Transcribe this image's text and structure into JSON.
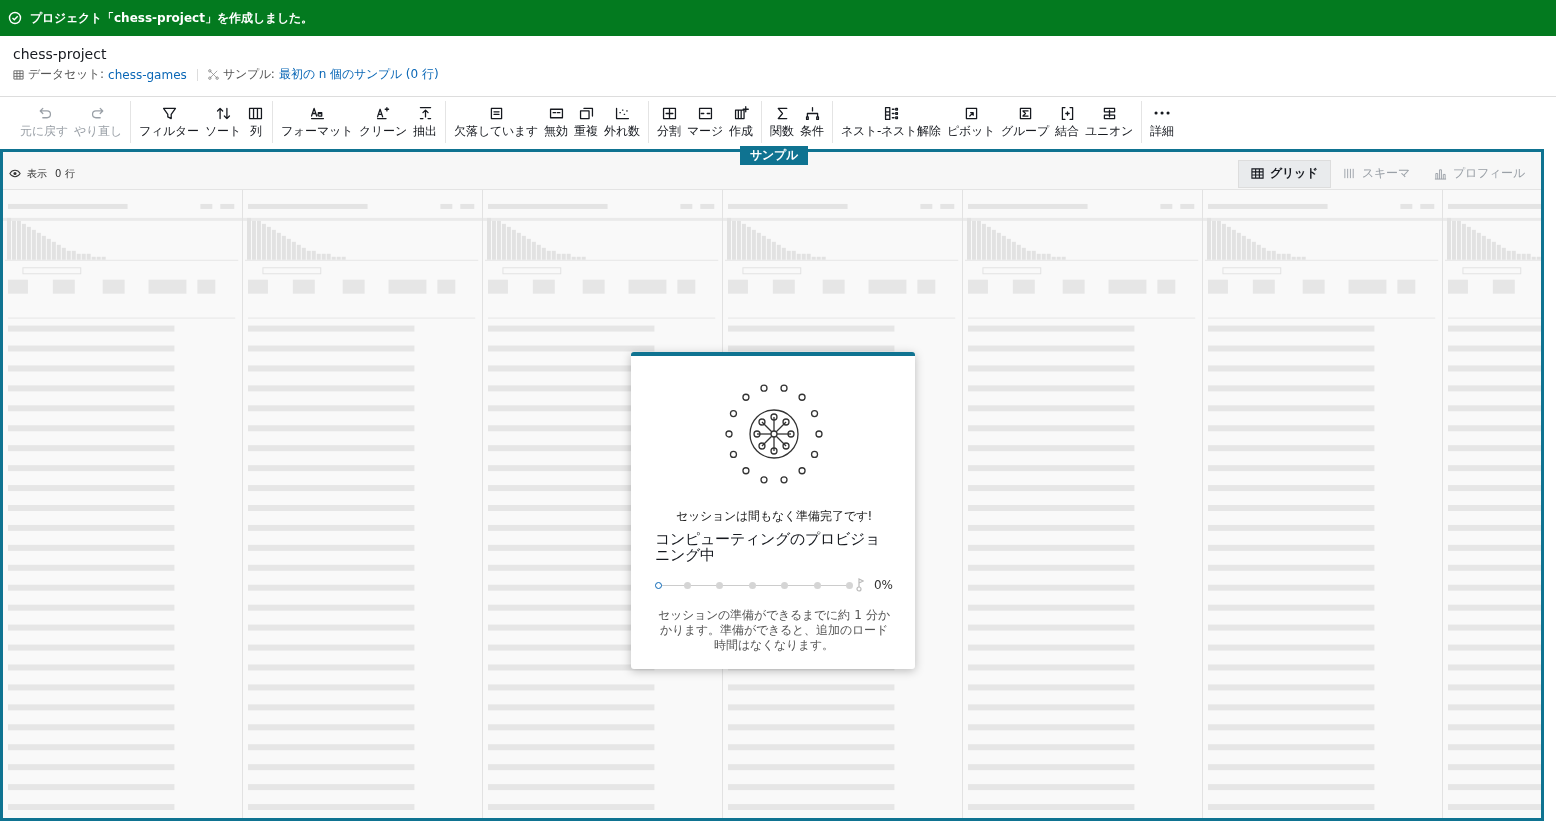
{
  "banner": {
    "message": "プロジェクト「chess-project」を作成しました。"
  },
  "project": {
    "title": "chess-project",
    "dataset_label": "データセット:",
    "dataset": "chess-games",
    "sample_label": "サンプル:",
    "sample": "最初の n 個のサンプル (0 行)"
  },
  "toolbar": {
    "groups": [
      {
        "items": [
          {
            "label": "元に戻す",
            "disabled": true
          },
          {
            "label": "やり直し",
            "disabled": true
          }
        ]
      },
      {
        "items": [
          {
            "label": "フィルター",
            "disabled": false
          },
          {
            "label": "ソート",
            "disabled": false
          },
          {
            "label": "列",
            "disabled": false
          }
        ]
      },
      {
        "items": [
          {
            "label": "フォーマット",
            "disabled": false
          },
          {
            "label": "クリーン",
            "disabled": false
          },
          {
            "label": "抽出",
            "disabled": false
          }
        ]
      },
      {
        "items": [
          {
            "label": "欠落しています",
            "disabled": false
          },
          {
            "label": "無効",
            "disabled": false
          },
          {
            "label": "重複",
            "disabled": false
          },
          {
            "label": "外れ数",
            "disabled": false
          }
        ]
      },
      {
        "items": [
          {
            "label": "分割",
            "disabled": false
          },
          {
            "label": "マージ",
            "disabled": false
          },
          {
            "label": "作成",
            "disabled": false
          }
        ]
      },
      {
        "items": [
          {
            "label": "関数",
            "disabled": false
          },
          {
            "label": "条件",
            "disabled": false
          }
        ]
      },
      {
        "items": [
          {
            "label": "ネスト-ネスト解除",
            "disabled": false
          },
          {
            "label": "ピボット",
            "disabled": false
          },
          {
            "label": "グループ",
            "disabled": false
          },
          {
            "label": "結合",
            "disabled": false
          },
          {
            "label": "ユニオン",
            "disabled": false
          }
        ]
      },
      {
        "items": [
          {
            "label": "詳細",
            "disabled": false
          }
        ]
      }
    ]
  },
  "sample_tag": "サンプル",
  "view": {
    "label": "表示",
    "rows": "0 行"
  },
  "view_tabs": [
    {
      "label": "グリッド",
      "selected": true
    },
    {
      "label": "スキーマ",
      "selected": false
    },
    {
      "label": "プロフィール",
      "selected": false
    }
  ],
  "dialog": {
    "subtitle": "セッションは間もなく準備完了です!",
    "title": "コンピューティングのプロビジョニング中",
    "progress": {
      "reading": "0%"
    },
    "note": "セッションの準備ができるまでに約 1 分かかります。準備ができると、追加のロード時間はなくなります。"
  }
}
